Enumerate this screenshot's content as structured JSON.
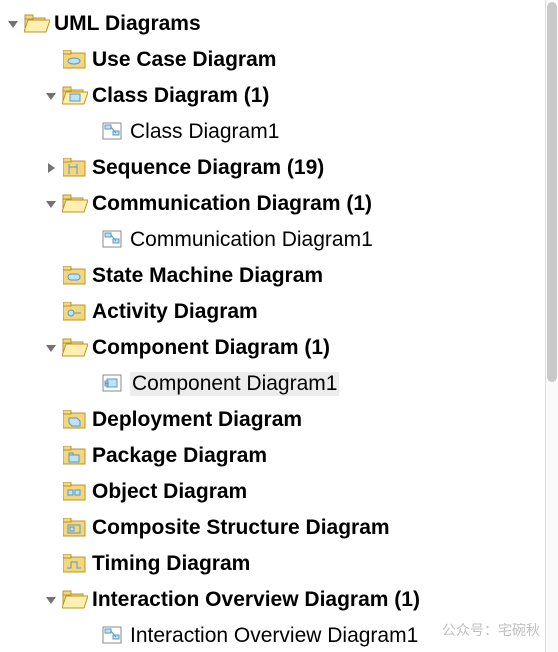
{
  "tree": {
    "root": {
      "label": "UML Diagrams",
      "children": [
        {
          "label": "Use Case Diagram",
          "arrow": "none",
          "icon": "folder-usecase"
        },
        {
          "label": "Class Diagram (1)",
          "arrow": "down",
          "icon": "folder-open",
          "children": [
            {
              "label": "Class Diagram1",
              "icon": "diagram"
            }
          ]
        },
        {
          "label": "Sequence Diagram (19)",
          "arrow": "right",
          "icon": "folder-seq"
        },
        {
          "label": "Communication Diagram (1)",
          "arrow": "down",
          "icon": "folder-open",
          "children": [
            {
              "label": "Communication Diagram1",
              "icon": "diagram"
            }
          ]
        },
        {
          "label": "State Machine Diagram",
          "arrow": "none",
          "icon": "folder-state"
        },
        {
          "label": "Activity Diagram",
          "arrow": "none",
          "icon": "folder-activity"
        },
        {
          "label": "Component Diagram (1)",
          "arrow": "down",
          "icon": "folder-open",
          "children": [
            {
              "label": "Component Diagram1",
              "icon": "diagram",
              "selected": true
            }
          ]
        },
        {
          "label": "Deployment Diagram",
          "arrow": "none",
          "icon": "folder-deploy"
        },
        {
          "label": "Package Diagram",
          "arrow": "none",
          "icon": "folder-package"
        },
        {
          "label": "Object Diagram",
          "arrow": "none",
          "icon": "folder-object"
        },
        {
          "label": "Composite Structure Diagram",
          "arrow": "none",
          "icon": "folder-composite"
        },
        {
          "label": "Timing Diagram",
          "arrow": "none",
          "icon": "folder-timing"
        },
        {
          "label": "Interaction Overview Diagram (1)",
          "arrow": "down",
          "icon": "folder-open",
          "children": [
            {
              "label": "Interaction Overview Diagram1",
              "icon": "diagram"
            }
          ]
        }
      ]
    }
  },
  "watermark": "公众号：宅碗秋"
}
